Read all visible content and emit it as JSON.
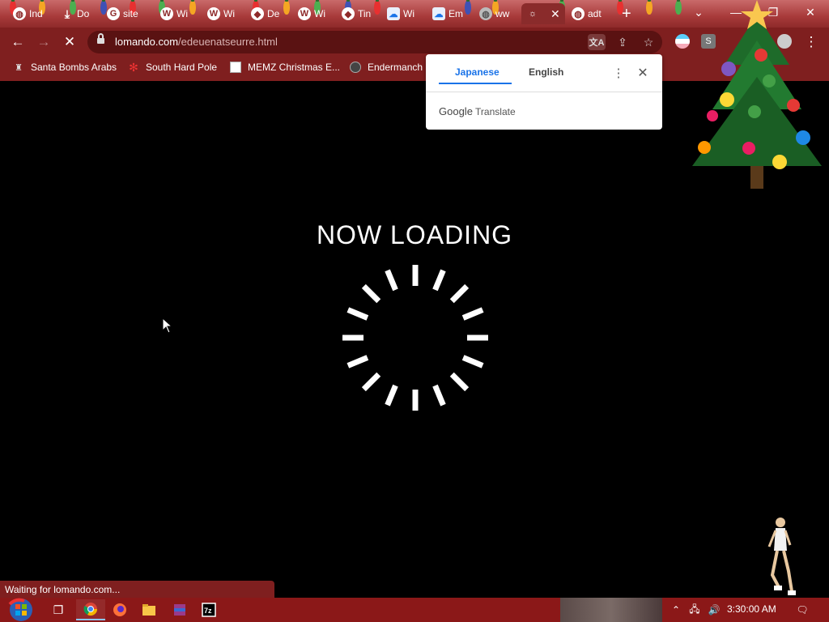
{
  "browser": {
    "tabs": [
      {
        "label": "Ind",
        "icon": "globe-icon"
      },
      {
        "label": "Do",
        "icon": "download-icon"
      },
      {
        "label": "site",
        "icon": "google-icon"
      },
      {
        "label": "Wi",
        "icon": "wikipedia-icon"
      },
      {
        "label": "Wi",
        "icon": "wikipedia-icon"
      },
      {
        "label": "De",
        "icon": "generic-icon"
      },
      {
        "label": "Wi",
        "icon": "wikipedia-icon"
      },
      {
        "label": "Tin",
        "icon": "generic-icon"
      },
      {
        "label": "Wi",
        "icon": "cloud-icon"
      },
      {
        "label": "Em",
        "icon": "cloud-icon"
      },
      {
        "label": "ww",
        "icon": "globe-icon"
      },
      {
        "label": "adt",
        "icon": "globe-icon"
      }
    ],
    "url_host": "lomando.com",
    "url_path": "/edeuenatseurre.html",
    "bookmarks": [
      {
        "label": "Santa Bombs Arabs",
        "icon": "bookmark-icon"
      },
      {
        "label": "South Hard Pole",
        "icon": "snowflake-icon"
      },
      {
        "label": "MEMZ Christmas E...",
        "icon": "memz-icon"
      },
      {
        "label": "Endermanch",
        "icon": "enderman-icon"
      }
    ],
    "status_text": "Waiting for lomando.com..."
  },
  "translate_popup": {
    "tab_source": "Japanese",
    "tab_target": "English",
    "brand_google": "Google",
    "brand_translate": "Translate"
  },
  "page": {
    "title": "NOW LOADING"
  },
  "taskbar": {
    "clock": "3:30:00 AM"
  },
  "colors": {
    "chrome_bg": "#7f1f1f",
    "taskbar_bg": "#8b1818",
    "page_bg": "#000000",
    "accent_blue": "#1a73e8"
  }
}
